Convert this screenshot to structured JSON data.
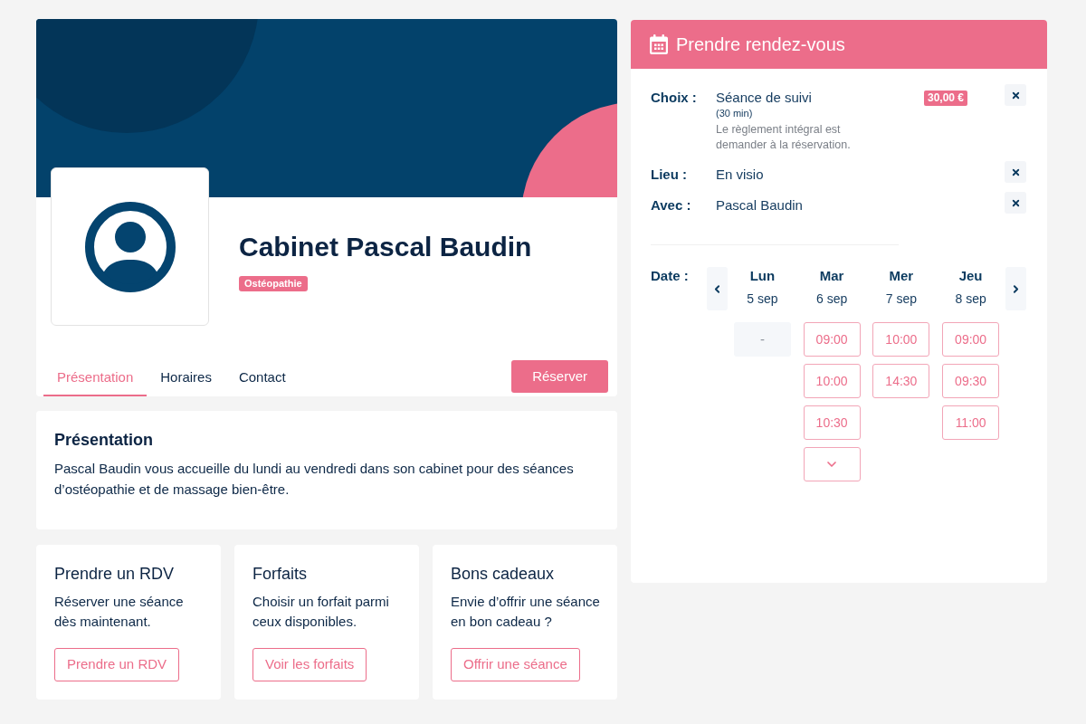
{
  "profile": {
    "name": "Cabinet Pascal Baudin",
    "specialty": "Ostéopathie",
    "tabs": [
      {
        "label": "Présentation",
        "selected": true
      },
      {
        "label": "Horaires",
        "selected": false
      },
      {
        "label": "Contact",
        "selected": false
      }
    ],
    "reserve_button": "Réserver"
  },
  "presentation": {
    "title": "Présentation",
    "text": "Pascal Baudin vous accueille du lundi au vendredi dans son cabinet pour des séances d’ostéopathie et de massage bien-être."
  },
  "cards": [
    {
      "title": "Prendre un RDV",
      "text": "Réserver une séance dès maintenant.",
      "button": "Prendre un RDV"
    },
    {
      "title": "Forfaits",
      "text": "Choisir un forfait parmi ceux disponibles.",
      "button": "Voir les forfaits"
    },
    {
      "title": "Bons cadeaux",
      "text": "Envie d’offrir une séance en bon cadeau ?",
      "button": "Offrir une séance"
    }
  ],
  "booking": {
    "title": "Prendre rendez-vous",
    "details": [
      {
        "label": "Choix :",
        "value": "Séance de suivi",
        "duration": "(30 min)",
        "note": "Le règlement intégral est demander à la réservation.",
        "price": "30,00 €"
      },
      {
        "label": "Lieu :",
        "value": "En visio"
      },
      {
        "label": "Avec :",
        "value": "Pascal Baudin"
      }
    ],
    "date_label": "Date :",
    "days": [
      {
        "day": "Lun",
        "date": "5 sep",
        "slots": [
          {
            "kind": "empty",
            "label": "-"
          }
        ]
      },
      {
        "day": "Mar",
        "date": "6 sep",
        "slots": [
          {
            "kind": "time",
            "label": "09:00"
          },
          {
            "kind": "time",
            "label": "10:00"
          },
          {
            "kind": "time",
            "label": "10:30"
          },
          {
            "kind": "more"
          }
        ]
      },
      {
        "day": "Mer",
        "date": "7 sep",
        "slots": [
          {
            "kind": "time",
            "label": "10:00"
          },
          {
            "kind": "time",
            "label": "14:30"
          }
        ]
      },
      {
        "day": "Jeu",
        "date": "8 sep",
        "slots": [
          {
            "kind": "time",
            "label": "09:00"
          },
          {
            "kind": "time",
            "label": "09:30"
          },
          {
            "kind": "time",
            "label": "11:00"
          }
        ]
      }
    ]
  }
}
